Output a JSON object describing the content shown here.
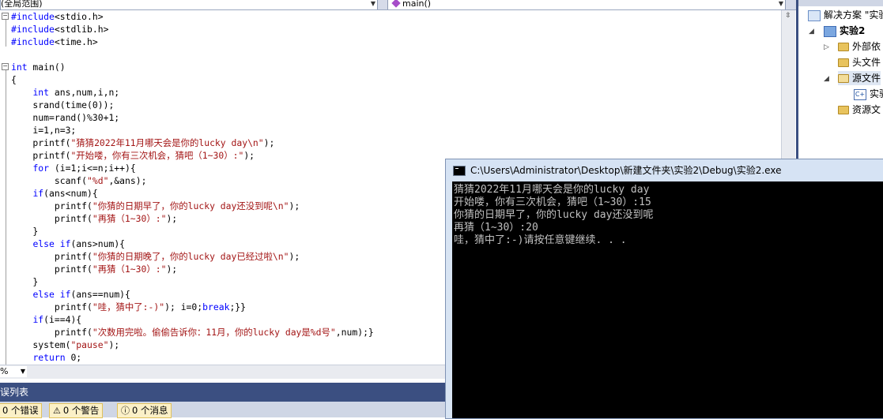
{
  "navbar": {
    "scope": "(全局范围)",
    "member": "main()"
  },
  "code_lines": [
    "#include<stdio.h>",
    "#include<stdlib.h>",
    "#include<time.h>",
    "",
    "int main()",
    "{",
    "    int ans,num,i,n;",
    "    srand(time(0));",
    "    num=rand()%30+1;",
    "    i=1,n=3;",
    "    printf(\"猜猜2022年11月哪天会是你的lucky day\\n\");",
    "    printf(\"开始喽，你有三次机会，猜吧（1~30）:\");",
    "    for (i=1;i<=n;i++){",
    "        scanf(\"%d\",&ans);",
    "    if(ans<num){",
    "        printf(\"你猜的日期早了，你的lucky day还没到呢\\n\");",
    "        printf(\"再猜（1~30）:\");",
    "    }",
    "    else if(ans>num){",
    "        printf(\"你猜的日期晚了，你的lucky day已经过啦\\n\");",
    "        printf(\"再猜（1~30）:\");",
    "    }",
    "    else if(ans==num){",
    "        printf(\"哇，猜中了:-)\"); i=0;break;}}",
    "    if(i==4){",
    "        printf(\"次数用完啦。偷偷告诉你：11月，你的lucky day是%d号\",num);}",
    "    system(\"pause\");",
    "    return 0;"
  ],
  "editor": {
    "zoom": "%"
  },
  "error_list": {
    "title": "误列表",
    "errors": "0 个错误",
    "warnings": "0 个警告",
    "messages": "0 个消息"
  },
  "solution_explorer": {
    "items": [
      {
        "label": "解决方案 \"实验"
      },
      {
        "label": "实验2"
      },
      {
        "label": "外部依"
      },
      {
        "label": "头文件"
      },
      {
        "label": "源文件"
      },
      {
        "label": "实验"
      },
      {
        "label": "资源文"
      }
    ]
  },
  "console": {
    "title": "C:\\Users\\Administrator\\Desktop\\新建文件夹\\实验2\\Debug\\实验2.exe",
    "lines": [
      "猜猜2022年11月哪天会是你的lucky day",
      "开始喽，你有三次机会，猜吧（1~30）:15",
      "你猜的日期早了，你的lucky day还没到呢",
      "再猜（1~30）:20",
      "哇，猜中了:-)请按任意键继续. . ."
    ]
  },
  "colors": {
    "keyword": "#0000ff",
    "string": "#a31515",
    "panel_title": "#3b4f81",
    "console_bg": "#000000",
    "console_text": "#c0c0c0"
  }
}
